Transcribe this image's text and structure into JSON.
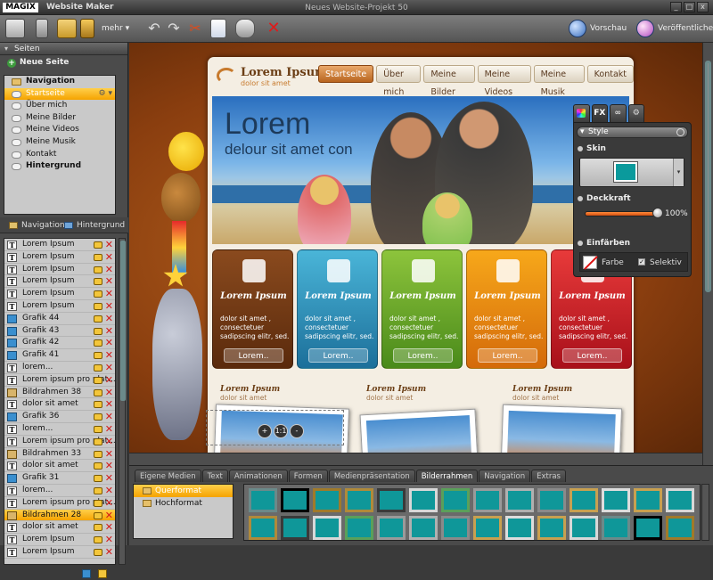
{
  "app": {
    "logo": "MAGIX",
    "name": "Website Maker",
    "title": "Neues Website-Projekt 50",
    "min": "_",
    "max": "□",
    "close": "x"
  },
  "toolbar": {
    "more": "mehr",
    "preview": "Vorschau",
    "publish": "Veröffentlichen"
  },
  "left": {
    "pages_header": "Seiten",
    "new_page": "Neue Seite",
    "tree": [
      {
        "label": "Navigation",
        "bold": true,
        "icon": "folder"
      },
      {
        "label": "Startseite",
        "selected": true
      },
      {
        "label": "Über mich"
      },
      {
        "label": "Meine Bilder"
      },
      {
        "label": "Meine Videos"
      },
      {
        "label": "Meine Musik"
      },
      {
        "label": "Kontakt"
      },
      {
        "label": "Hintergrund",
        "bold": true
      }
    ],
    "tab_navigation": "Navigation",
    "tab_background": "Hintergrund",
    "objects": [
      {
        "label": "Lorem Ipsum",
        "t": "text"
      },
      {
        "label": "Lorem Ipsum",
        "t": "text"
      },
      {
        "label": "Lorem Ipsum",
        "t": "text"
      },
      {
        "label": "Lorem Ipsum",
        "t": "text"
      },
      {
        "label": "Lorem Ipsum",
        "t": "text"
      },
      {
        "label": "Lorem Ipsum",
        "t": "text"
      },
      {
        "label": "Grafik 44",
        "t": "img"
      },
      {
        "label": "Grafik 43",
        "t": "img"
      },
      {
        "label": "Grafik 42",
        "t": "img"
      },
      {
        "label": "Grafik 41",
        "t": "img"
      },
      {
        "label": "lorem...",
        "t": "text"
      },
      {
        "label": "Lorem ipsum pro plat...",
        "t": "text"
      },
      {
        "label": "Bildrahmen 38",
        "t": "fr"
      },
      {
        "label": "dolor sit amet",
        "t": "text"
      },
      {
        "label": "Grafik 36",
        "t": "img"
      },
      {
        "label": "lorem...",
        "t": "text"
      },
      {
        "label": "Lorem ipsum pro plat...",
        "t": "text"
      },
      {
        "label": "Bildrahmen 33",
        "t": "fr"
      },
      {
        "label": "dolor sit amet",
        "t": "text"
      },
      {
        "label": "Grafik 31",
        "t": "img"
      },
      {
        "label": "lorem...",
        "t": "text"
      },
      {
        "label": "Lorem ipsum pro plat...",
        "t": "text"
      },
      {
        "label": "Bildrahmen 28",
        "t": "fr",
        "selected": true
      },
      {
        "label": "dolor sit amet",
        "t": "text"
      },
      {
        "label": "Lorem Ipsum",
        "t": "text"
      },
      {
        "label": "Lorem Ipsum",
        "t": "text"
      }
    ]
  },
  "site": {
    "title": "Lorem Ipsum",
    "subtitle": "dolor sit amet",
    "nav": [
      "Startseite",
      "Über mich",
      "Meine Bilder",
      "Meine Videos",
      "Meine Musik",
      "Kontakt"
    ],
    "hero_title": "Lorem",
    "hero_sub": "delour sit amet con",
    "cards": [
      {
        "title": "Lorem Ipsum",
        "text": "dolor sit amet , consectetuer sadipscing elitr, sed.",
        "button": "Lorem..",
        "color": "#8a4a1e",
        "color2": "#5a2a0c"
      },
      {
        "title": "Lorem Ipsum",
        "text": "dolor sit amet , consectetuer sadipscing elitr, sed.",
        "button": "Lorem..",
        "color": "#4ab5d8",
        "color2": "#1c6f9a"
      },
      {
        "title": "Lorem Ipsum",
        "text": "dolor sit amet , consectetuer sadipscing elitr, sed.",
        "button": "Lorem..",
        "color": "#8dc43c",
        "color2": "#4a8a1a"
      },
      {
        "title": "Lorem Ipsum",
        "text": "dolor sit amet , consectetuer sadipscing elitr, sed.",
        "button": "Lorem..",
        "color": "#f7a81a",
        "color2": "#d46a0a"
      },
      {
        "title": "Lorem Ipsum",
        "text": "dolor sit amet , consectetuer sadipscing elitr, sed.",
        "button": "Lorem..",
        "color": "#e83a3a",
        "color2": "#a8101a"
      }
    ],
    "lower": [
      {
        "title": "Lorem Ipsum",
        "sub": "dolor sit amet"
      },
      {
        "title": "Lorem Ipsum",
        "sub": "dolor sit amet"
      },
      {
        "title": "Lorem Ipsum",
        "sub": "dolor sit amet"
      }
    ],
    "zoom": [
      "+",
      "1:1",
      "-"
    ]
  },
  "panel": {
    "tabs": [
      "",
      "FX",
      "",
      ""
    ],
    "section": "Style",
    "skin": "Skin",
    "opacity": "Deckkraft",
    "opacity_value": "100%",
    "opacity_fraction": 1.0,
    "tint": "Einfärben",
    "color": "Farbe",
    "selective": "Selektiv"
  },
  "bottom": {
    "tabs": [
      "Eigene Medien",
      "Text",
      "Animationen",
      "Formen",
      "Medienpräsentation",
      "Bilderrahmen",
      "Navigation",
      "Extras"
    ],
    "active_tab": "Bilderrahmen",
    "tree": [
      {
        "label": "Querformat",
        "selected": true
      },
      {
        "label": "Hochformat"
      }
    ]
  }
}
